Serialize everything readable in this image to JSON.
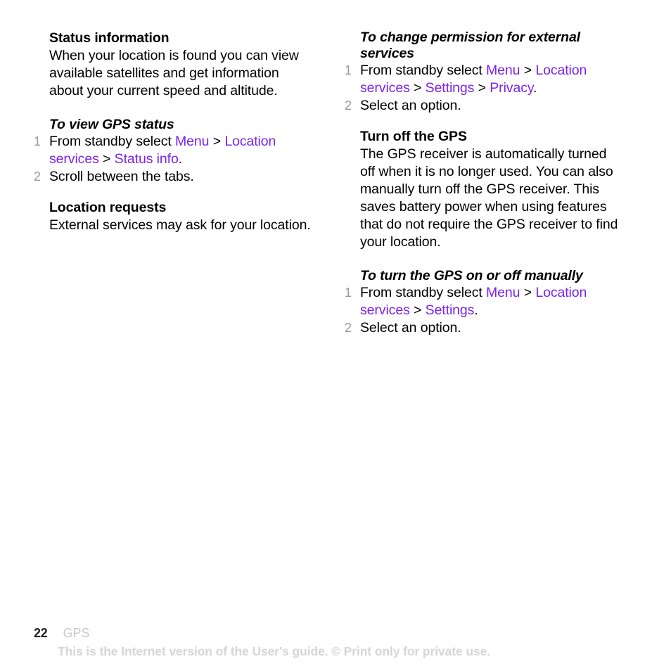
{
  "document": {
    "page_number": "22",
    "section": "GPS",
    "disclaimer": "This is the Internet version of the User's guide. © Print only for private use."
  },
  "left_column": {
    "status_information": {
      "heading": "Status information",
      "body": "When your location is found you can view available satellites and get information about your current speed and altitude."
    },
    "to_view_gps_status": {
      "heading": "To view GPS status",
      "steps": [
        {
          "number": "1",
          "prefix": "From standby select ",
          "link1": "Menu",
          "sep1": " > ",
          "link2": "Location services",
          "sep2": " > ",
          "link3": "Status info",
          "suffix": "."
        },
        {
          "number": "2",
          "text": "Scroll between the tabs."
        }
      ]
    },
    "location_requests": {
      "heading": "Location requests",
      "body": "External services may ask for your location."
    }
  },
  "right_column": {
    "to_change_permission": {
      "heading": "To change permission for external services",
      "steps": [
        {
          "number": "1",
          "prefix": "From standby select ",
          "link1": "Menu",
          "sep1": " > ",
          "link2": "Location services",
          "sep2": " > ",
          "link3": "Settings",
          "sep3": " > ",
          "link4": "Privacy",
          "suffix": "."
        },
        {
          "number": "2",
          "text": "Select an option."
        }
      ]
    },
    "turn_off_the_gps": {
      "heading": "Turn off the GPS",
      "body": "The GPS receiver is automatically turned off when it is no longer used. You can also manually turn off the GPS receiver. This saves battery power when using features that do not require the GPS receiver to find your location."
    },
    "to_turn_gps_on_or_off": {
      "heading": "To turn the GPS on or off manually",
      "steps": [
        {
          "number": "1",
          "prefix": "From standby select ",
          "link1": "Menu",
          "sep1": " > ",
          "link2": "Location services",
          "sep2": " > ",
          "link3": "Settings",
          "suffix": "."
        },
        {
          "number": "2",
          "text": "Select an option."
        }
      ]
    }
  },
  "colors": {
    "link": "#7b22ee",
    "step_number": "#999999",
    "footer_muted": "#c9c9c9",
    "disclaimer": "#d6d6d6",
    "text": "#000000"
  }
}
